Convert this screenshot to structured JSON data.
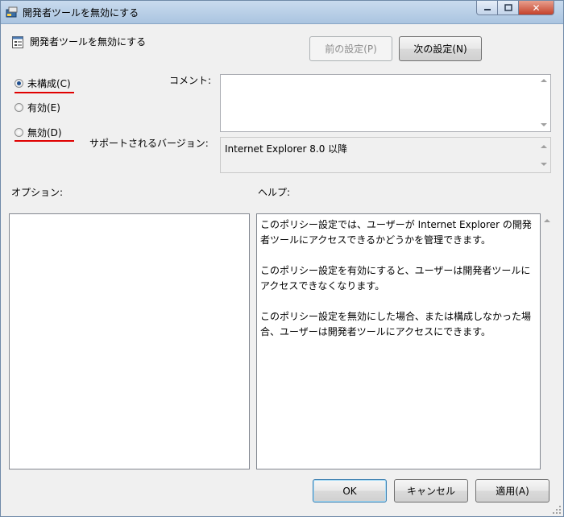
{
  "window": {
    "title": "開発者ツールを無効にする",
    "close_glyph": "✕"
  },
  "policy_title": "開発者ツールを無効にする",
  "nav": {
    "prev_label": "前の設定(P)",
    "next_label": "次の設定(N)"
  },
  "options": {
    "not_configured": "未構成(C)",
    "enabled": "有効(E)",
    "disabled": "無効(D)",
    "selected": "not_configured"
  },
  "comment": {
    "label": "コメント:",
    "value": ""
  },
  "supported": {
    "label": "サポートされるバージョン:",
    "value": "Internet Explorer 8.0 以降"
  },
  "options_label": "オプション:",
  "help": {
    "label": "ヘルプ:",
    "paragraphs": [
      "このポリシー設定では、ユーザーが Internet Explorer の開発者ツールにアクセスできるかどうかを管理できます。",
      "このポリシー設定を有効にすると、ユーザーは開発者ツールにアクセスできなくなります。",
      "このポリシー設定を無効にした場合、または構成しなかった場合、ユーザーは開発者ツールにアクセスにできます。"
    ]
  },
  "buttons": {
    "ok": "OK",
    "cancel": "キャンセル",
    "apply": "適用(A)"
  },
  "colors": {
    "accent_underline": "#e00000",
    "titlebar": "#aac4e0"
  }
}
